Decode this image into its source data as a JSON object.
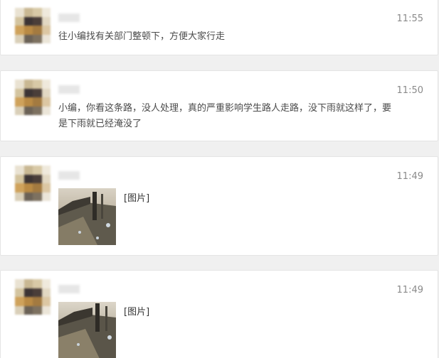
{
  "messages": [
    {
      "time": "11:55",
      "text": "往小编找有关部门整顿下，方便大家行走"
    },
    {
      "time": "11:50",
      "text": "小编，你看这条路，没人处理，真的严重影响学生路人走路，没下雨就这样了，要是下雨就已经淹没了"
    },
    {
      "time": "11:49",
      "image_label": "[图片]"
    },
    {
      "time": "11:49",
      "image_label": "[图片]"
    }
  ],
  "colors": {
    "page_bg": "#f0f0f0",
    "card_bg": "#ffffff",
    "card_border": "#e4e4e4",
    "time_text": "#8a8a8a",
    "body_text": "#4a4a4a"
  }
}
